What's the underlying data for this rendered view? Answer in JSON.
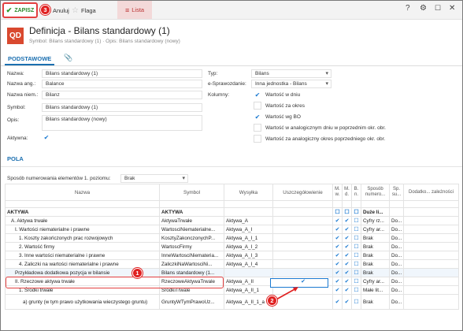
{
  "toolbar": {
    "save_label": "ZAPISZ",
    "cancel_label": "Anuluj",
    "flag_label": "Flaga",
    "list_label": "Lista",
    "help_glyph": "?",
    "markers": [
      "1",
      "2",
      "3"
    ]
  },
  "header": {
    "badge": "QD",
    "title": "Definicja - Bilans standardowy (1)",
    "subtitle": "Symbol: Bilans standardowy (1)  ·  Opis: Bilans standardowy (nowy)"
  },
  "tabs": {
    "main": "PODSTAWOWE"
  },
  "form": {
    "name_label": "Nazwa:",
    "name_value": "Bilans standardowy (1)",
    "name_eng_label": "Nazwa ang.:",
    "name_eng_value": "Balance",
    "name_ger_label": "Nazwa niem.:",
    "name_ger_value": "Bilanz",
    "symbol_label": "Symbol:",
    "symbol_value": "Bilans standardowy (1)",
    "desc_label": "Opis:",
    "desc_value": "Bilans standardowy (nowy)",
    "active_label": "Aktywna:",
    "type_label": "Typ:",
    "type_value": "Bilans",
    "ereport_label": "e-Sprawozdanie:",
    "ereport_value": "Inna jednostka - Bilans",
    "columns_label": "Kolumny:",
    "columns": [
      {
        "label": "Wartość w dniu",
        "checked": true
      },
      {
        "label": "Wartość za okres",
        "checked": false
      },
      {
        "label": "Wartość wg BO",
        "checked": true
      },
      {
        "label": "Wartość w analogicznym dniu w poprzednim okr. obr.",
        "checked": false
      },
      {
        "label": "Wartość za analogiczny okres poprzedniego okr. obr.",
        "checked": false
      }
    ]
  },
  "section": {
    "title": "POLA"
  },
  "numbering": {
    "label": "Sposób numerowania elementów 1. poziomu:",
    "value": "Brak"
  },
  "grid": {
    "headers": [
      "Nazwa",
      "Symbol",
      "Wysyłka",
      "Uszczegółowienie",
      "M. w.",
      "M. d.",
      "B. n.",
      "Sposób numero...",
      "Sp. su...",
      "Dodatko... zależności"
    ],
    "rows": [
      {
        "name": "AKTYWA",
        "symbol": "AKTYWA",
        "send": "",
        "m1": "☐",
        "m2": "☐",
        "b": "☐",
        "num": "Duże li...",
        "sp": "",
        "bold": true
      },
      {
        "name": "A. Aktywa trwałe",
        "symbol": "AktywaTrwałe",
        "send": "Aktywa_A",
        "m1": "✔",
        "m2": "✔",
        "b": "☐",
        "num": "Cyfry rz...",
        "sp": "Do..."
      },
      {
        "name": "I. Wartości niematerialne i prawne",
        "symbol": "WartosciNiematerialne...",
        "send": "Aktywa_A_I",
        "m1": "✔",
        "m2": "✔",
        "b": "☐",
        "num": "Cyfry ar...",
        "sp": "Do..."
      },
      {
        "name": "1. Koszty zakończonych prac rozwojowych",
        "symbol": "KosztyZakonczonychP...",
        "send": "Aktywa_A_I_1",
        "m1": "✔",
        "m2": "✔",
        "b": "☐",
        "num": "Brak",
        "sp": "Do..."
      },
      {
        "name": "2. Wartość firmy",
        "symbol": "WartoscFirmy",
        "send": "Aktywa_A_I_2",
        "m1": "✔",
        "m2": "✔",
        "b": "☐",
        "num": "Brak",
        "sp": "Do..."
      },
      {
        "name": "3. Inne wartości niematerialne i prawne",
        "symbol": "InneWartosciNiemateria...",
        "send": "Aktywa_A_I_3",
        "m1": "✔",
        "m2": "✔",
        "b": "☐",
        "num": "Brak",
        "sp": "Do..."
      },
      {
        "name": "4. Zaliczki na wartości niematerialne i prawne",
        "symbol": "ZaliczkiNaWartosciNi...",
        "send": "Aktywa_A_I_4",
        "m1": "✔",
        "m2": "✔",
        "b": "☐",
        "num": "Brak",
        "sp": "Do..."
      },
      {
        "name": "Przykładowa dodatkowa pozycja w bilansie",
        "symbol": "Bilans standardowy (1...",
        "send": "",
        "m1": "✔",
        "m2": "✔",
        "b": "☐",
        "num": "Brak",
        "sp": "Do...",
        "highlight": true,
        "detail_checked": true
      },
      {
        "name": "II. Rzeczowe aktywa trwałe",
        "symbol": "RzeczoweAktywaTrwale",
        "send": "Aktywa_A_II",
        "m1": "✔",
        "m2": "✔",
        "b": "☐",
        "num": "Cyfry ar...",
        "sp": "Do..."
      },
      {
        "name": "1. Środki trwałe",
        "symbol": "SrodkiTrwale",
        "send": "Aktywa_A_II_1",
        "m1": "✔",
        "m2": "✔",
        "b": "☐",
        "num": "Małe lit...",
        "sp": "Do..."
      },
      {
        "name": "a) grunty (w tym prawo użytkowania wieczystego gruntu)",
        "symbol": "GruntyWTymPrawoUz...",
        "send": "Aktywa_A_II_1_a",
        "m1": "✔",
        "m2": "✔",
        "b": "☐",
        "num": "Brak",
        "sp": "Do...",
        "tall": true
      }
    ]
  }
}
